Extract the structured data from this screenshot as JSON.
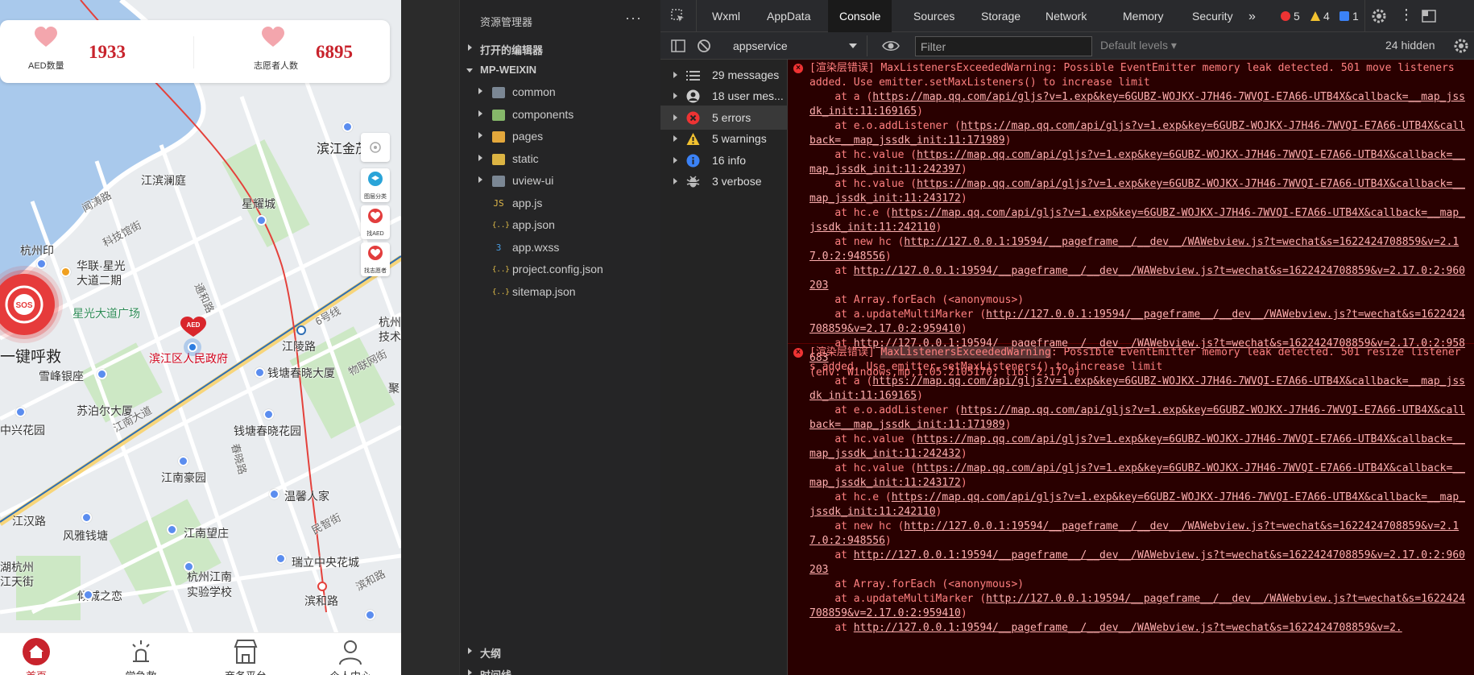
{
  "simulator": {
    "stats": {
      "aed_label": "AED数量",
      "aed_value": "1933",
      "volunteer_label": "志愿者人数",
      "volunteer_value": "6895"
    },
    "side_tools": [
      {
        "label": "图层分类",
        "icon": "layers-icon"
      },
      {
        "label": "找AED",
        "icon": "aed-heart-icon"
      },
      {
        "label": "找志愿者",
        "icon": "volunteer-heart-icon"
      }
    ],
    "sos_text": "SOS",
    "sos_label": "一键呼救",
    "aed_marker_text": "AED",
    "map_labels": [
      {
        "text": "滨江金茂",
        "cls": "big"
      },
      {
        "text": "江滨澜庭",
        "cls": ""
      },
      {
        "text": "星耀城",
        "cls": ""
      },
      {
        "text": "杭州印",
        "cls": ""
      },
      {
        "text": "华联·星光",
        "cls": ""
      },
      {
        "text": "大道二期",
        "cls": ""
      },
      {
        "text": "星光大道广场",
        "cls": "green"
      },
      {
        "text": "滨江区人民政府",
        "cls": "red"
      },
      {
        "text": "江陵路",
        "cls": ""
      },
      {
        "text": "雪峰银座",
        "cls": ""
      },
      {
        "text": "钱塘春晓大厦",
        "cls": ""
      },
      {
        "text": "苏泊尔大厦",
        "cls": ""
      },
      {
        "text": "中兴花园",
        "cls": ""
      },
      {
        "text": "钱塘春晓花园",
        "cls": ""
      },
      {
        "text": "江南豪园",
        "cls": ""
      },
      {
        "text": "温馨人家",
        "cls": ""
      },
      {
        "text": "江汉路",
        "cls": ""
      },
      {
        "text": "风雅钱塘",
        "cls": ""
      },
      {
        "text": "江南望庄",
        "cls": ""
      },
      {
        "text": "瑞立中央花城",
        "cls": ""
      },
      {
        "text": "湖杭州",
        "cls": ""
      },
      {
        "text": "江天街",
        "cls": ""
      },
      {
        "text": "杭州江南",
        "cls": ""
      },
      {
        "text": "实验学校",
        "cls": ""
      },
      {
        "text": "倾城之恋",
        "cls": ""
      },
      {
        "text": "滨和路",
        "cls": ""
      },
      {
        "text": "江南大道",
        "cls": "road"
      },
      {
        "text": "闻涛路",
        "cls": "road"
      },
      {
        "text": "科技馆街",
        "cls": "road"
      },
      {
        "text": "通和路",
        "cls": "road"
      },
      {
        "text": "物联网街",
        "cls": "road"
      },
      {
        "text": "春晓路",
        "cls": "road"
      },
      {
        "text": "民智街",
        "cls": "road"
      },
      {
        "text": "滨和路",
        "cls": "road"
      },
      {
        "text": "杭州",
        "cls": ""
      },
      {
        "text": "技术",
        "cls": ""
      },
      {
        "text": "聚",
        "cls": ""
      },
      {
        "text": "6号线",
        "cls": "road"
      }
    ],
    "tabs": [
      {
        "label": "首页",
        "icon": "home-icon"
      },
      {
        "label": "学急救",
        "icon": "lamp-icon"
      },
      {
        "label": "商务平台",
        "icon": "shop-icon"
      },
      {
        "label": "个人中心",
        "icon": "user-icon"
      }
    ]
  },
  "explorer": {
    "title": "资源管理器",
    "more": "···",
    "open_editors": "打开的编辑器",
    "project": "MP-WEIXIN",
    "items": [
      {
        "name": "common",
        "type": "folder"
      },
      {
        "name": "components",
        "type": "folder-green"
      },
      {
        "name": "pages",
        "type": "folder-orange"
      },
      {
        "name": "static",
        "type": "folder-yellow"
      },
      {
        "name": "uview-ui",
        "type": "folder"
      },
      {
        "name": "app.js",
        "type": "js"
      },
      {
        "name": "app.json",
        "type": "json"
      },
      {
        "name": "app.wxss",
        "type": "css"
      },
      {
        "name": "project.config.json",
        "type": "json"
      },
      {
        "name": "sitemap.json",
        "type": "json"
      }
    ],
    "bottom": [
      "大纲",
      "时间线"
    ]
  },
  "devtools": {
    "tabs": [
      "Wxml",
      "AppData",
      "Console",
      "Sources",
      "Storage",
      "Network",
      "Memory",
      "Security"
    ],
    "active_tab": "Console",
    "more_tabs": "»",
    "errors": "5",
    "warnings": "4",
    "infos": "1",
    "context": "appservice",
    "filter_placeholder": "Filter",
    "levels": "Default levels",
    "hidden": "24 hidden",
    "sidebar": [
      {
        "label": "29 messages",
        "icon": "list-icon"
      },
      {
        "label": "18 user mes...",
        "icon": "user-circle-icon"
      },
      {
        "label": "5 errors",
        "icon": "error-icon"
      },
      {
        "label": "5 warnings",
        "icon": "warning-icon"
      },
      {
        "label": "16 info",
        "icon": "info-icon"
      },
      {
        "label": "3 verbose",
        "icon": "bug-icon"
      }
    ],
    "messages": [
      {
        "prefix": "[渲染层错误]",
        "name": "MaxListenersExceededWarning",
        "text": ": Possible EventEmitter memory leak detected. 501 move listeners added. Use emitter.setMaxListeners() to increase limit",
        "frames": [
          [
            "    at a (",
            "https://map.qq.com/api/gljs?v=1.exp&key=6GUBZ-WOJKX-J7H46-7WVQI-E7A66-UTB4X&callback=__map_jssdk_init:11:169165",
            ")"
          ],
          [
            "    at e.o.addListener (",
            "https://map.qq.com/api/gljs?v=1.exp&key=6GUBZ-WOJKX-J7H46-7WVQI-E7A66-UTB4X&callback=__map_jssdk_init:11:171989",
            ")"
          ],
          [
            "    at hc.value (",
            "https://map.qq.com/api/gljs?v=1.exp&key=6GUBZ-WOJKX-J7H46-7WVQI-E7A66-UTB4X&callback=__map_jssdk_init:11:242397",
            ")"
          ],
          [
            "    at hc.value (",
            "https://map.qq.com/api/gljs?v=1.exp&key=6GUBZ-WOJKX-J7H46-7WVQI-E7A66-UTB4X&callback=__map_jssdk_init:11:243172",
            ")"
          ],
          [
            "    at hc.e (",
            "https://map.qq.com/api/gljs?v=1.exp&key=6GUBZ-WOJKX-J7H46-7WVQI-E7A66-UTB4X&callback=__map_jssdk_init:11:242110",
            ")"
          ],
          [
            "    at new hc (",
            "http://127.0.0.1:19594/__pageframe__/__dev__/WAWebview.js?t=wechat&s=1622424708859&v=2.17.0:2:948556",
            ")"
          ],
          [
            "    at ",
            "http://127.0.0.1:19594/__pageframe__/__dev__/WAWebview.js?t=wechat&s=1622424708859&v=2.17.0:2:960203",
            ""
          ],
          [
            "    at Array.forEach (<anonymous>)",
            "",
            ""
          ],
          [
            "    at a.updateMultiMarker (",
            "http://127.0.0.1:19594/__pageframe__/__dev__/WAWebview.js?t=wechat&s=1622424708859&v=2.17.0:2:959410",
            ")"
          ],
          [
            "    at ",
            "http://127.0.0.1:19594/__pageframe__/__dev__/WAWebview.js?t=wechat&s=1622424708859&v=2.17.0:2:958683",
            ""
          ]
        ],
        "env": "(env: Windows,mp,1.05.2105170; lib: 2.17.0)"
      },
      {
        "prefix": "[渲染层错误]",
        "name": "MaxListenersExceededWarning",
        "text": ": Possible EventEmitter memory leak detected. 501 resize listeners added. Use emitter.setMaxListeners() to increase limit",
        "frames": [
          [
            "    at a (",
            "https://map.qq.com/api/gljs?v=1.exp&key=6GUBZ-WOJKX-J7H46-7WVQI-E7A66-UTB4X&callback=__map_jssdk_init:11:169165",
            ")"
          ],
          [
            "    at e.o.addListener (",
            "https://map.qq.com/api/gljs?v=1.exp&key=6GUBZ-WOJKX-J7H46-7WVQI-E7A66-UTB4X&callback=__map_jssdk_init:11:171989",
            ")"
          ],
          [
            "    at hc.value (",
            "https://map.qq.com/api/gljs?v=1.exp&key=6GUBZ-WOJKX-J7H46-7WVQI-E7A66-UTB4X&callback=__map_jssdk_init:11:242432",
            ")"
          ],
          [
            "    at hc.value (",
            "https://map.qq.com/api/gljs?v=1.exp&key=6GUBZ-WOJKX-J7H46-7WVQI-E7A66-UTB4X&callback=__map_jssdk_init:11:243172",
            ")"
          ],
          [
            "    at hc.e (",
            "https://map.qq.com/api/gljs?v=1.exp&key=6GUBZ-WOJKX-J7H46-7WVQI-E7A66-UTB4X&callback=__map_jssdk_init:11:242110",
            ")"
          ],
          [
            "    at new hc (",
            "http://127.0.0.1:19594/__pageframe__/__dev__/WAWebview.js?t=wechat&s=1622424708859&v=2.17.0:2:948556",
            ")"
          ],
          [
            "    at ",
            "http://127.0.0.1:19594/__pageframe__/__dev__/WAWebview.js?t=wechat&s=1622424708859&v=2.17.0:2:960203",
            ""
          ],
          [
            "    at Array.forEach (<anonymous>)",
            "",
            ""
          ],
          [
            "    at a.updateMultiMarker (",
            "http://127.0.0.1:19594/__pageframe__/__dev__/WAWebview.js?t=wechat&s=1622424708859&v=2.17.0:2:959410",
            ")"
          ],
          [
            "    at ",
            "http://127.0.0.1:19594/__pageframe__/__dev__/WAWebview.js?t=wechat&s=1622424708859&v=2.",
            ""
          ]
        ],
        "env": ""
      }
    ]
  },
  "colors": {
    "brand_red": "#c8232c",
    "console_bg": "#290000",
    "console_text": "#ff8080"
  }
}
